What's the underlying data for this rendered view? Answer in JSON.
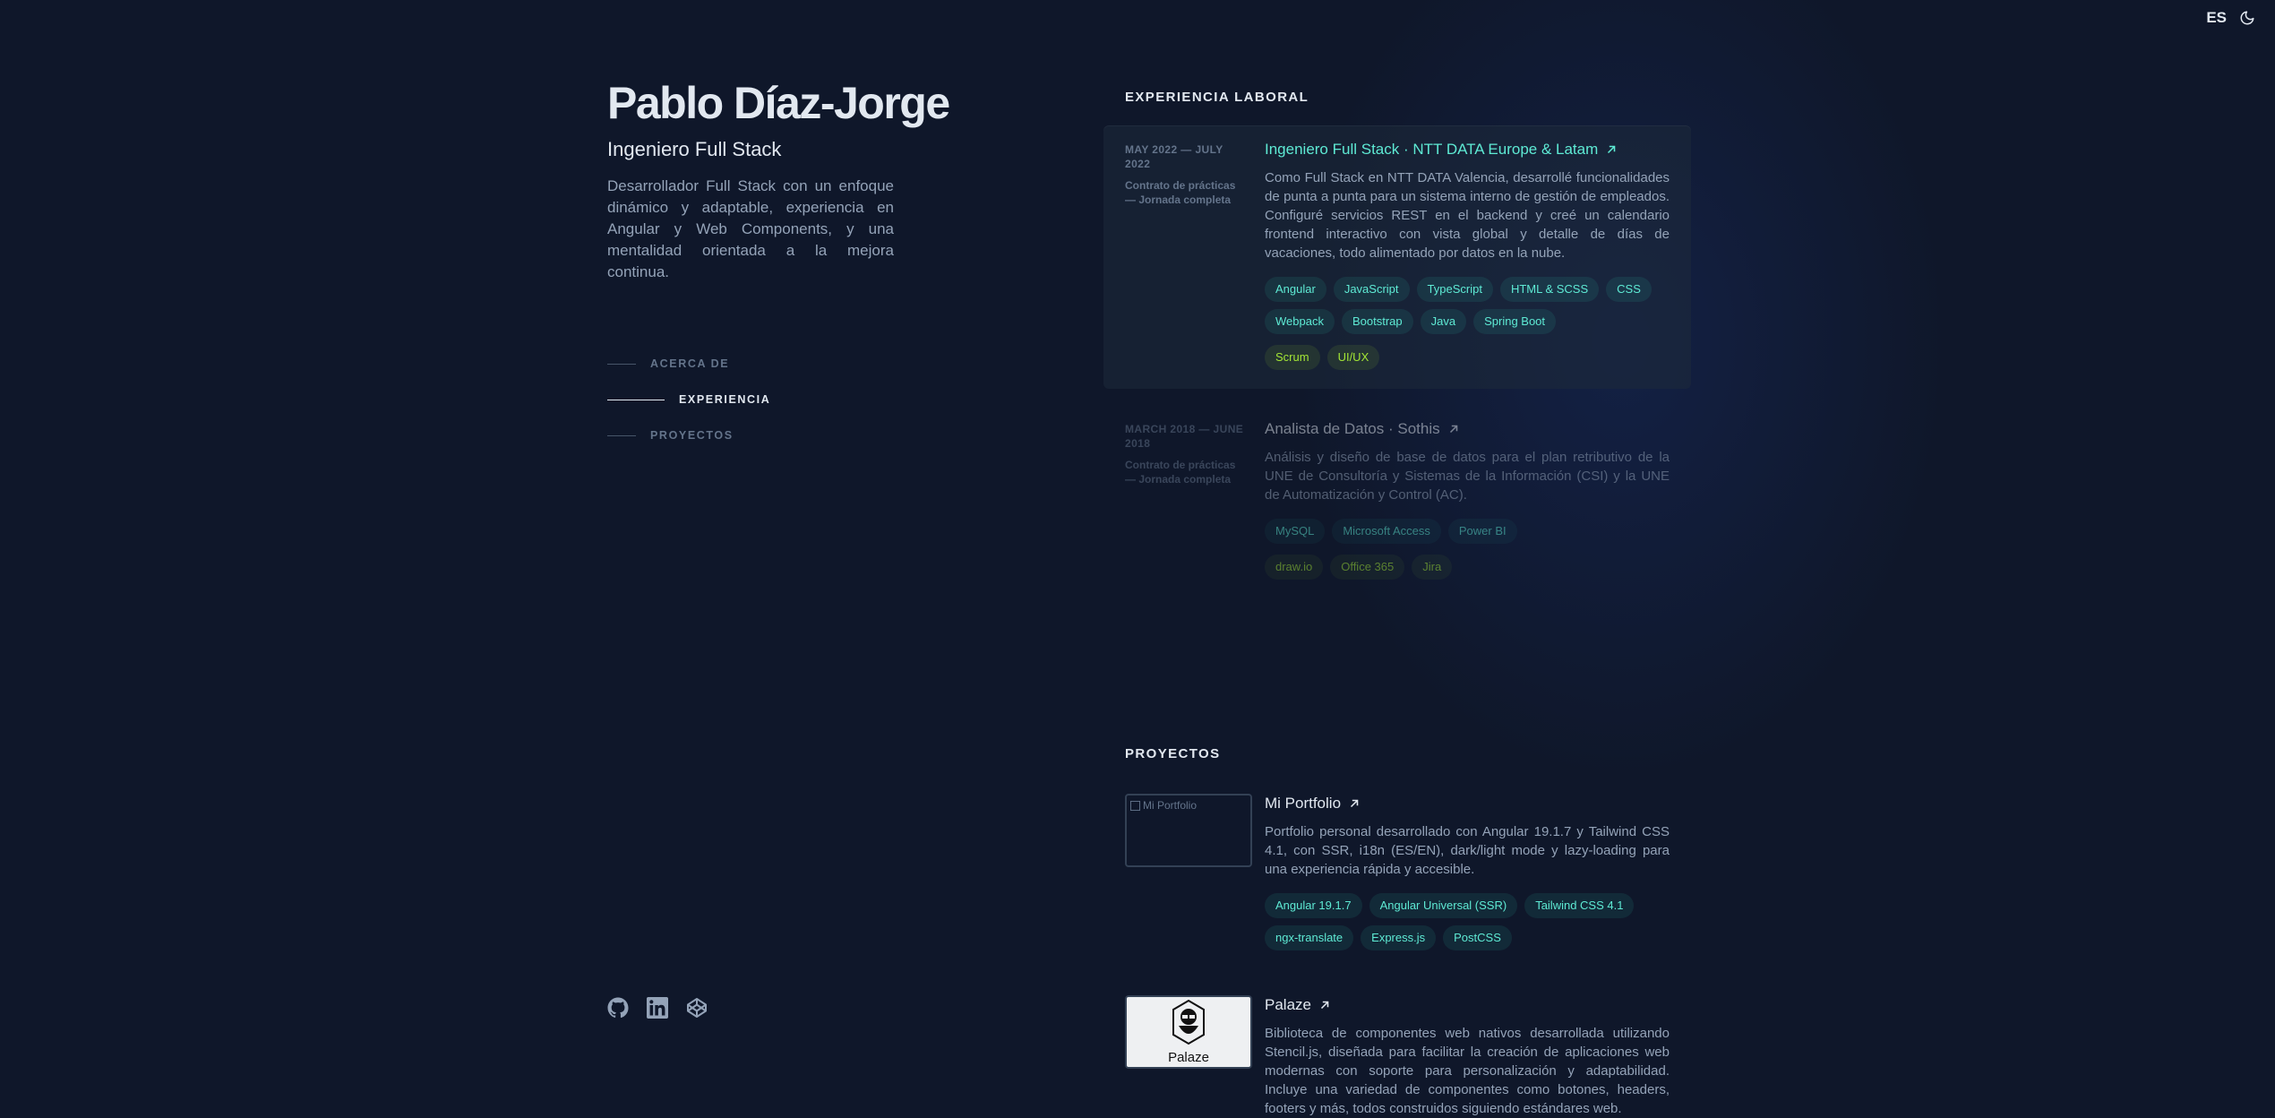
{
  "header": {
    "lang_label": "ES",
    "theme_icon": "moon-icon"
  },
  "profile": {
    "name": "Pablo Díaz-Jorge",
    "role": "Ingeniero Full Stack",
    "bio": "Desarrollador Full Stack con un enfoque dinámico y adaptable, experiencia en Angular y Web Components, y una mentalidad orientada a la mejora continua."
  },
  "nav": {
    "items": [
      {
        "label": "ACERCA DE",
        "active": false
      },
      {
        "label": "EXPERIENCIA",
        "active": true
      },
      {
        "label": "PROYECTOS",
        "active": false
      }
    ]
  },
  "socials": [
    "github-icon",
    "linkedin-icon",
    "codepen-icon"
  ],
  "experience": {
    "section_title": "EXPERIENCIA LABORAL",
    "jobs": [
      {
        "date": "MAY 2022 — JULY 2022",
        "contract": "Contrato de prácticas — Jornada completa",
        "title": "Ingeniero Full Stack · NTT DATA Europe & Latam",
        "description": "Como Full Stack en NTT DATA Valencia, desarrollé funcionalidades de punta a punta para un sistema interno de gestión de empleados. Configuré servicios REST en el backend y creé un calendario frontend interactivo con vista global y detalle de días de vacaciones, todo alimentado por datos en la nube.",
        "tags": [
          "Angular",
          "JavaScript",
          "TypeScript",
          "HTML & SCSS",
          "CSS",
          "Webpack",
          "Bootstrap",
          "Java",
          "Spring Boot"
        ],
        "soft_tags": [
          "Scrum",
          "UI/UX"
        ]
      },
      {
        "date": "MARCH 2018 — JUNE 2018",
        "contract": "Contrato de prácticas — Jornada completa",
        "title": "Analista de Datos · Sothis",
        "description": "Análisis y diseño de base de datos para el plan retributivo de la UNE de Consultoría y Sistemas de la Información (CSI) y la UNE de Automatización y Control (AC).",
        "tags": [
          "MySQL",
          "Microsoft Access",
          "Power BI"
        ],
        "soft_tags": [
          "draw.io",
          "Office 365",
          "Jira"
        ]
      }
    ]
  },
  "projects": {
    "section_title": "PROYECTOS",
    "items": [
      {
        "title": "Mi Portfolio",
        "image_alt": "Mi Portfolio",
        "description": "Portfolio personal desarrollado con Angular 19.1.7 y Tailwind CSS 4.1, con SSR, i18n (ES/EN), dark/light mode y lazy-loading para una experiencia rápida y accesible.",
        "tags": [
          "Angular 19.1.7",
          "Angular Universal (SSR)",
          "Tailwind CSS 4.1",
          "ngx-translate",
          "Express.js",
          "PostCSS"
        ]
      },
      {
        "title": "Palaze",
        "logo_text": "Palaze",
        "description": "Biblioteca de componentes web nativos desarrollada utilizando Stencil.js, diseñada para facilitar la creación de aplicaciones web modernas con soporte para personalización y adaptabilidad. Incluye una variedad de componentes como botones, headers, footers y más, todos construidos siguiendo estándares web."
      }
    ]
  },
  "colors": {
    "background": "#0f172a",
    "accent": "#5eead4",
    "lime": "#a3e635",
    "heading": "#e2e8f0",
    "body_text": "#94a3b8"
  }
}
